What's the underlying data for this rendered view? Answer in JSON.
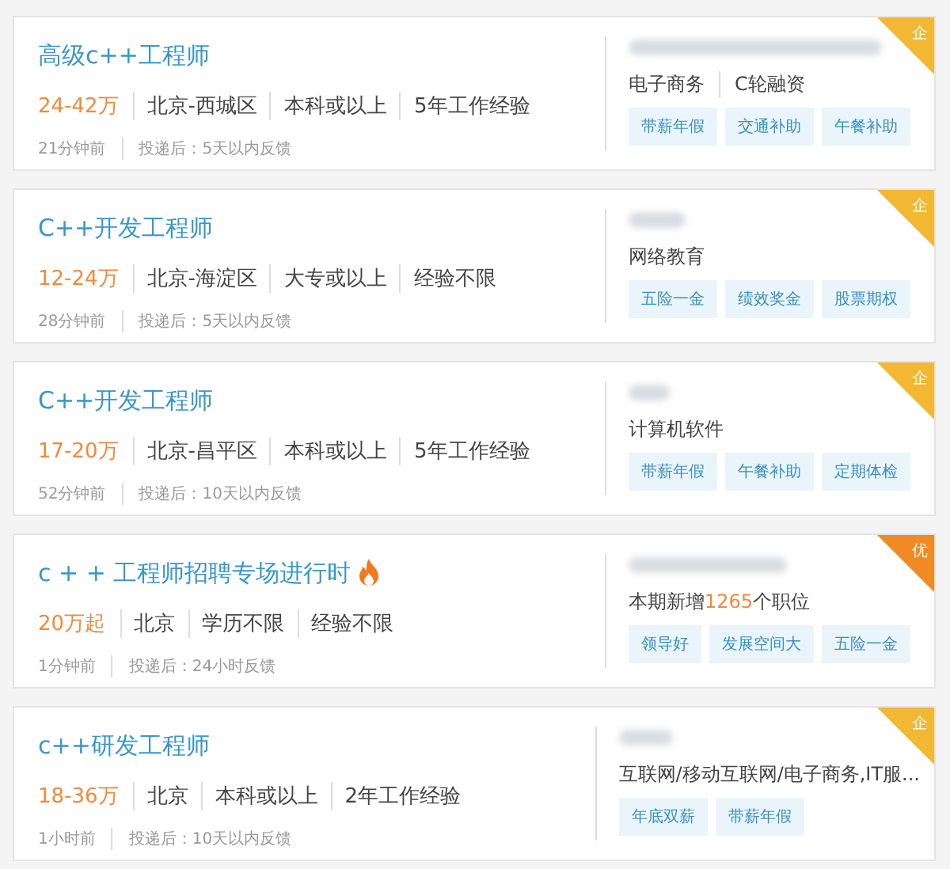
{
  "jobs": [
    {
      "title": "高级c++工程师",
      "hot": false,
      "salary": "24-42万",
      "details": [
        "北京-西城区",
        "本科或以上",
        "5年工作经验"
      ],
      "posted": "21分钟前",
      "feedback": "投递后：5天以内反馈",
      "company": {
        "kind": "segments",
        "segments": [
          {
            "text": "电子商务",
            "highlight": false
          },
          {
            "text": "C轮融资",
            "highlight": false
          }
        ],
        "tags": [
          "带薪年假",
          "交通补助",
          "午餐补助"
        ]
      },
      "badge": {
        "label": "企",
        "color": "#f2b733"
      }
    },
    {
      "title": "C++开发工程师",
      "hot": false,
      "salary": "12-24万",
      "details": [
        "北京-海淀区",
        "大专或以上",
        "经验不限"
      ],
      "posted": "28分钟前",
      "feedback": "投递后：5天以内反馈",
      "company": {
        "kind": "segments",
        "segments": [
          {
            "text": "网络教育",
            "highlight": false
          }
        ],
        "tags": [
          "五险一金",
          "绩效奖金",
          "股票期权"
        ]
      },
      "badge": {
        "label": "企",
        "color": "#f2b733"
      }
    },
    {
      "title": "C++开发工程师",
      "hot": false,
      "salary": "17-20万",
      "details": [
        "北京-昌平区",
        "本科或以上",
        "5年工作经验"
      ],
      "posted": "52分钟前",
      "feedback": "投递后：10天以内反馈",
      "company": {
        "kind": "segments",
        "segments": [
          {
            "text": "计算机软件",
            "highlight": false
          }
        ],
        "tags": [
          "带薪年假",
          "午餐补助",
          "定期体检"
        ]
      },
      "badge": {
        "label": "企",
        "color": "#f2b733"
      }
    },
    {
      "title": "c + + 工程师招聘专场进行时",
      "hot": true,
      "salary": "20万起",
      "details": [
        "北京",
        "学历不限",
        "经验不限"
      ],
      "posted": "1分钟前",
      "feedback": "投递后：24小时反馈",
      "company": {
        "kind": "sentence",
        "segments": [
          {
            "text": "本期新增",
            "highlight": false
          },
          {
            "text": "1265",
            "highlight": true
          },
          {
            "text": "个职位",
            "highlight": false
          }
        ],
        "tags": [
          "领导好",
          "发展空间大",
          "五险一金"
        ]
      },
      "badge": {
        "label": "优",
        "color": "#f08a24"
      }
    },
    {
      "title": "c++研发工程师",
      "hot": false,
      "salary": "18-36万",
      "details": [
        "北京",
        "本科或以上",
        "2年工作经验"
      ],
      "posted": "1小时前",
      "feedback": "投递后：10天以内反馈",
      "company": {
        "kind": "segments",
        "segments": [
          {
            "text": "互联网/移动互联网/电子商务,IT服...",
            "highlight": false
          }
        ],
        "tags": [
          "年底双薪",
          "带薪年假"
        ]
      },
      "badge": {
        "label": "企",
        "color": "#f2b733"
      }
    }
  ]
}
